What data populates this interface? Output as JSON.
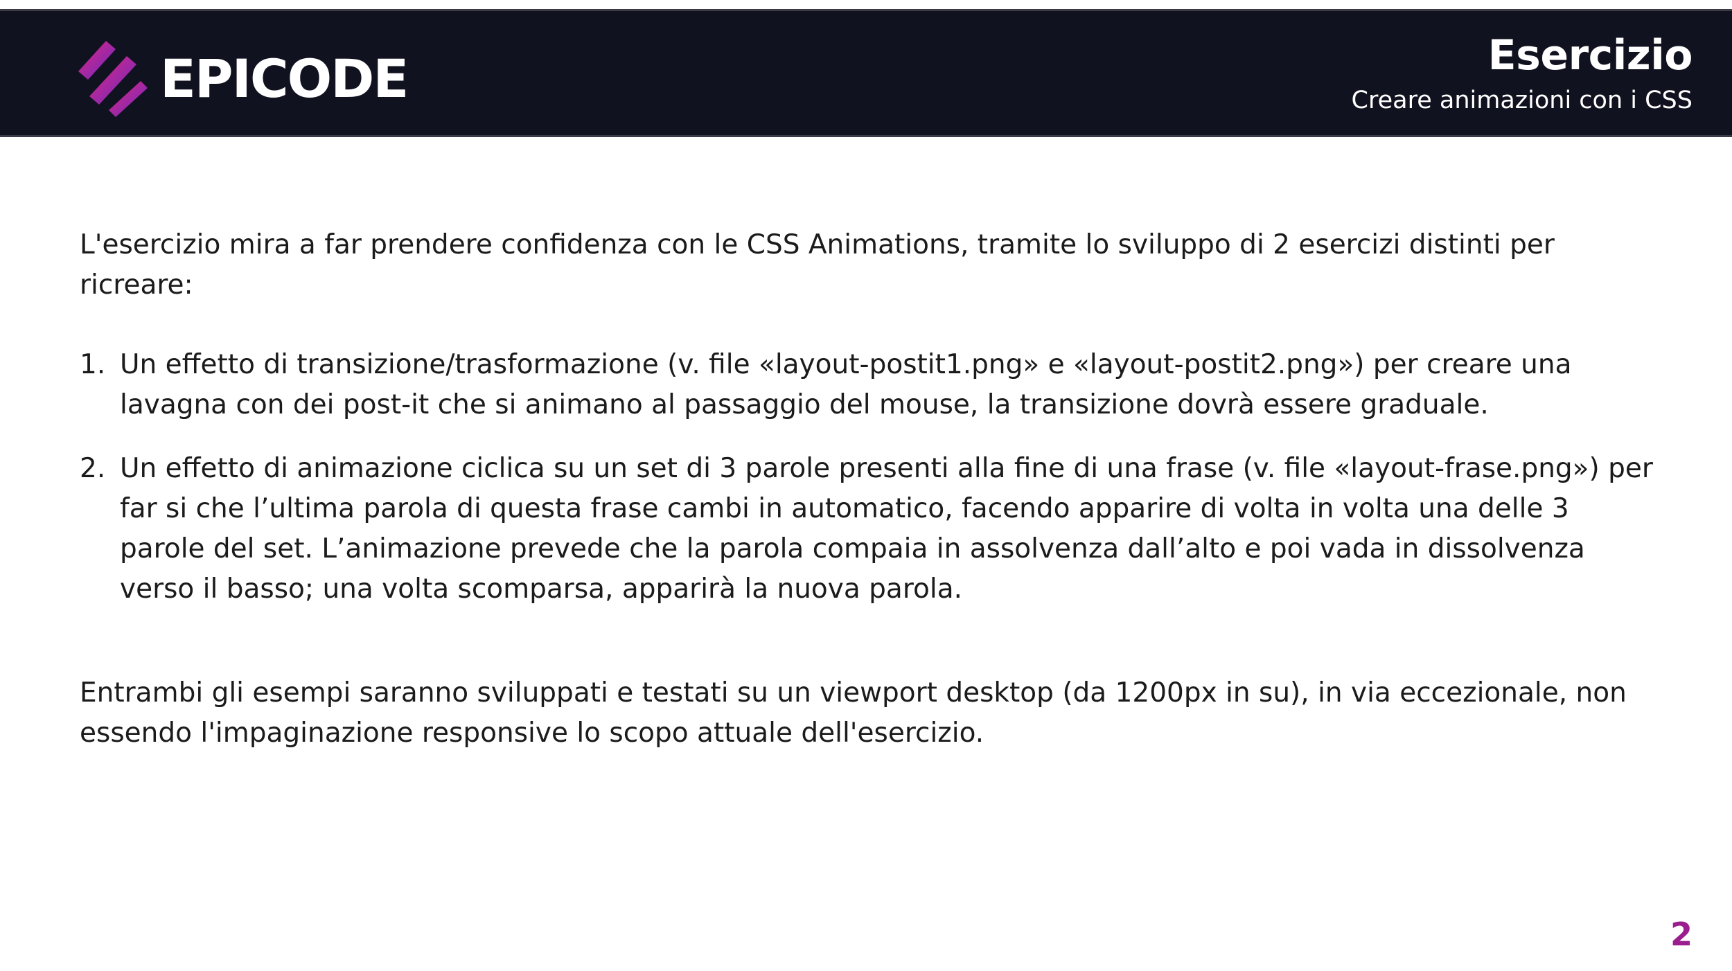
{
  "header": {
    "brand": "EPICODE",
    "title": "Esercizio",
    "subtitle": "Creare animazioni con i CSS"
  },
  "content": {
    "intro": "L'esercizio mira a far prendere confidenza con le CSS Animations, tramite lo sviluppo di 2 esercizi distinti per ricreare:",
    "steps": [
      {
        "number": "1.",
        "text": "Un effetto di transizione/trasformazione (v. file «layout-postit1.png» e «layout-postit2.png») per creare una lavagna con dei post-it che si animano al passaggio del mouse, la transizione dovrà essere graduale."
      },
      {
        "number": "2.",
        "text": "Un effetto di animazione ciclica su un set di 3 parole presenti alla fine di una frase (v. file «layout-frase.png») per far si che l’ultima parola di questa frase cambi in automatico, facendo apparire di volta in volta una delle 3 parole del set. L’animazione prevede che la parola compaia in assolvenza dall’alto e poi vada in dissolvenza verso il basso; una volta scomparsa, apparirà la nuova parola."
      }
    ],
    "outro": "Entrambi gli esempi saranno sviluppati e testati su un viewport desktop (da 1200px in su), in via eccezionale, non essendo l'impaginazione responsive lo scopo attuale dell'esercizio."
  },
  "page_number": "2",
  "colors": {
    "header_background": "#11121f",
    "brand_gradient_start": "#e0267a",
    "brand_gradient_end": "#6a2ac8",
    "page_number": "#9b1e8e"
  },
  "icons": {
    "logo": "epicode-logo-icon"
  }
}
